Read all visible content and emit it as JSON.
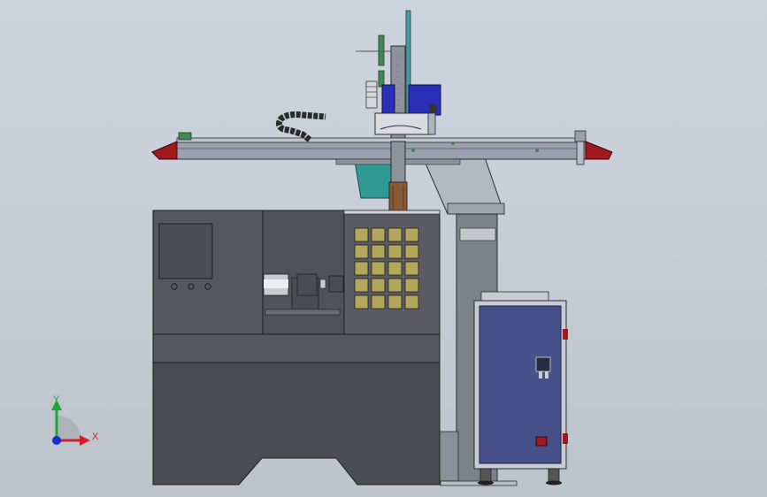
{
  "viewport": {
    "background_top": "#cdd3dc",
    "background_bottom": "#bdc3cb"
  },
  "triad": {
    "y_label": "Y",
    "x_label": "X",
    "y_color": "#1fa53a",
    "x_color": "#d0202a",
    "origin_color": "#1a2fd0"
  },
  "colors": {
    "machine_body": "#55575c",
    "machine_dark": "#3f4145",
    "gantry_beam": "#9aa0ad",
    "end_cap": "#a01820",
    "teal_panel": "#2f9a93",
    "cabinet_door": "#46508a",
    "cabinet_frame": "#c8ccd2",
    "tool_grid": "#b3a85a",
    "motor_blue": "#2a2fb8",
    "chain_black": "#2a2a2a"
  }
}
